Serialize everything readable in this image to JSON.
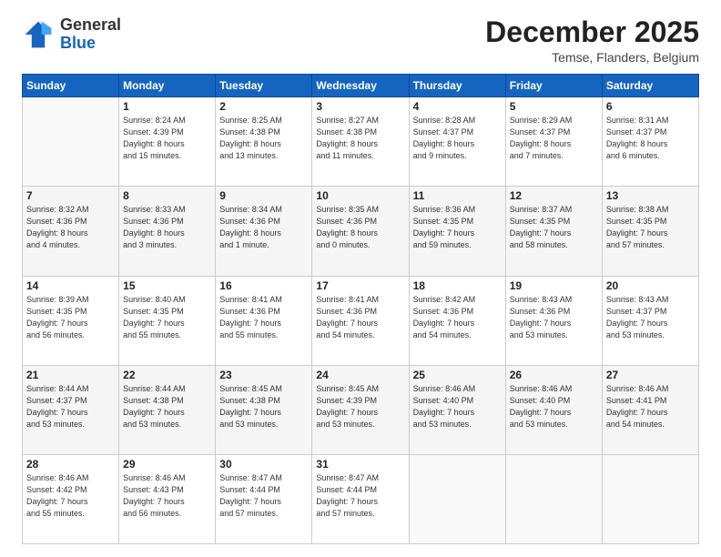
{
  "header": {
    "logo_general": "General",
    "logo_blue": "Blue",
    "month_title": "December 2025",
    "location": "Temse, Flanders, Belgium"
  },
  "weekdays": [
    "Sunday",
    "Monday",
    "Tuesday",
    "Wednesday",
    "Thursday",
    "Friday",
    "Saturday"
  ],
  "weeks": [
    [
      {
        "day": "",
        "info": ""
      },
      {
        "day": "1",
        "info": "Sunrise: 8:24 AM\nSunset: 4:39 PM\nDaylight: 8 hours\nand 15 minutes."
      },
      {
        "day": "2",
        "info": "Sunrise: 8:25 AM\nSunset: 4:38 PM\nDaylight: 8 hours\nand 13 minutes."
      },
      {
        "day": "3",
        "info": "Sunrise: 8:27 AM\nSunset: 4:38 PM\nDaylight: 8 hours\nand 11 minutes."
      },
      {
        "day": "4",
        "info": "Sunrise: 8:28 AM\nSunset: 4:37 PM\nDaylight: 8 hours\nand 9 minutes."
      },
      {
        "day": "5",
        "info": "Sunrise: 8:29 AM\nSunset: 4:37 PM\nDaylight: 8 hours\nand 7 minutes."
      },
      {
        "day": "6",
        "info": "Sunrise: 8:31 AM\nSunset: 4:37 PM\nDaylight: 8 hours\nand 6 minutes."
      }
    ],
    [
      {
        "day": "7",
        "info": "Sunrise: 8:32 AM\nSunset: 4:36 PM\nDaylight: 8 hours\nand 4 minutes."
      },
      {
        "day": "8",
        "info": "Sunrise: 8:33 AM\nSunset: 4:36 PM\nDaylight: 8 hours\nand 3 minutes."
      },
      {
        "day": "9",
        "info": "Sunrise: 8:34 AM\nSunset: 4:36 PM\nDaylight: 8 hours\nand 1 minute."
      },
      {
        "day": "10",
        "info": "Sunrise: 8:35 AM\nSunset: 4:36 PM\nDaylight: 8 hours\nand 0 minutes."
      },
      {
        "day": "11",
        "info": "Sunrise: 8:36 AM\nSunset: 4:35 PM\nDaylight: 7 hours\nand 59 minutes."
      },
      {
        "day": "12",
        "info": "Sunrise: 8:37 AM\nSunset: 4:35 PM\nDaylight: 7 hours\nand 58 minutes."
      },
      {
        "day": "13",
        "info": "Sunrise: 8:38 AM\nSunset: 4:35 PM\nDaylight: 7 hours\nand 57 minutes."
      }
    ],
    [
      {
        "day": "14",
        "info": "Sunrise: 8:39 AM\nSunset: 4:35 PM\nDaylight: 7 hours\nand 56 minutes."
      },
      {
        "day": "15",
        "info": "Sunrise: 8:40 AM\nSunset: 4:35 PM\nDaylight: 7 hours\nand 55 minutes."
      },
      {
        "day": "16",
        "info": "Sunrise: 8:41 AM\nSunset: 4:36 PM\nDaylight: 7 hours\nand 55 minutes."
      },
      {
        "day": "17",
        "info": "Sunrise: 8:41 AM\nSunset: 4:36 PM\nDaylight: 7 hours\nand 54 minutes."
      },
      {
        "day": "18",
        "info": "Sunrise: 8:42 AM\nSunset: 4:36 PM\nDaylight: 7 hours\nand 54 minutes."
      },
      {
        "day": "19",
        "info": "Sunrise: 8:43 AM\nSunset: 4:36 PM\nDaylight: 7 hours\nand 53 minutes."
      },
      {
        "day": "20",
        "info": "Sunrise: 8:43 AM\nSunset: 4:37 PM\nDaylight: 7 hours\nand 53 minutes."
      }
    ],
    [
      {
        "day": "21",
        "info": "Sunrise: 8:44 AM\nSunset: 4:37 PM\nDaylight: 7 hours\nand 53 minutes."
      },
      {
        "day": "22",
        "info": "Sunrise: 8:44 AM\nSunset: 4:38 PM\nDaylight: 7 hours\nand 53 minutes."
      },
      {
        "day": "23",
        "info": "Sunrise: 8:45 AM\nSunset: 4:38 PM\nDaylight: 7 hours\nand 53 minutes."
      },
      {
        "day": "24",
        "info": "Sunrise: 8:45 AM\nSunset: 4:39 PM\nDaylight: 7 hours\nand 53 minutes."
      },
      {
        "day": "25",
        "info": "Sunrise: 8:46 AM\nSunset: 4:40 PM\nDaylight: 7 hours\nand 53 minutes."
      },
      {
        "day": "26",
        "info": "Sunrise: 8:46 AM\nSunset: 4:40 PM\nDaylight: 7 hours\nand 53 minutes."
      },
      {
        "day": "27",
        "info": "Sunrise: 8:46 AM\nSunset: 4:41 PM\nDaylight: 7 hours\nand 54 minutes."
      }
    ],
    [
      {
        "day": "28",
        "info": "Sunrise: 8:46 AM\nSunset: 4:42 PM\nDaylight: 7 hours\nand 55 minutes."
      },
      {
        "day": "29",
        "info": "Sunrise: 8:46 AM\nSunset: 4:43 PM\nDaylight: 7 hours\nand 56 minutes."
      },
      {
        "day": "30",
        "info": "Sunrise: 8:47 AM\nSunset: 4:44 PM\nDaylight: 7 hours\nand 57 minutes."
      },
      {
        "day": "31",
        "info": "Sunrise: 8:47 AM\nSunset: 4:44 PM\nDaylight: 7 hours\nand 57 minutes."
      },
      {
        "day": "",
        "info": ""
      },
      {
        "day": "",
        "info": ""
      },
      {
        "day": "",
        "info": ""
      }
    ]
  ]
}
